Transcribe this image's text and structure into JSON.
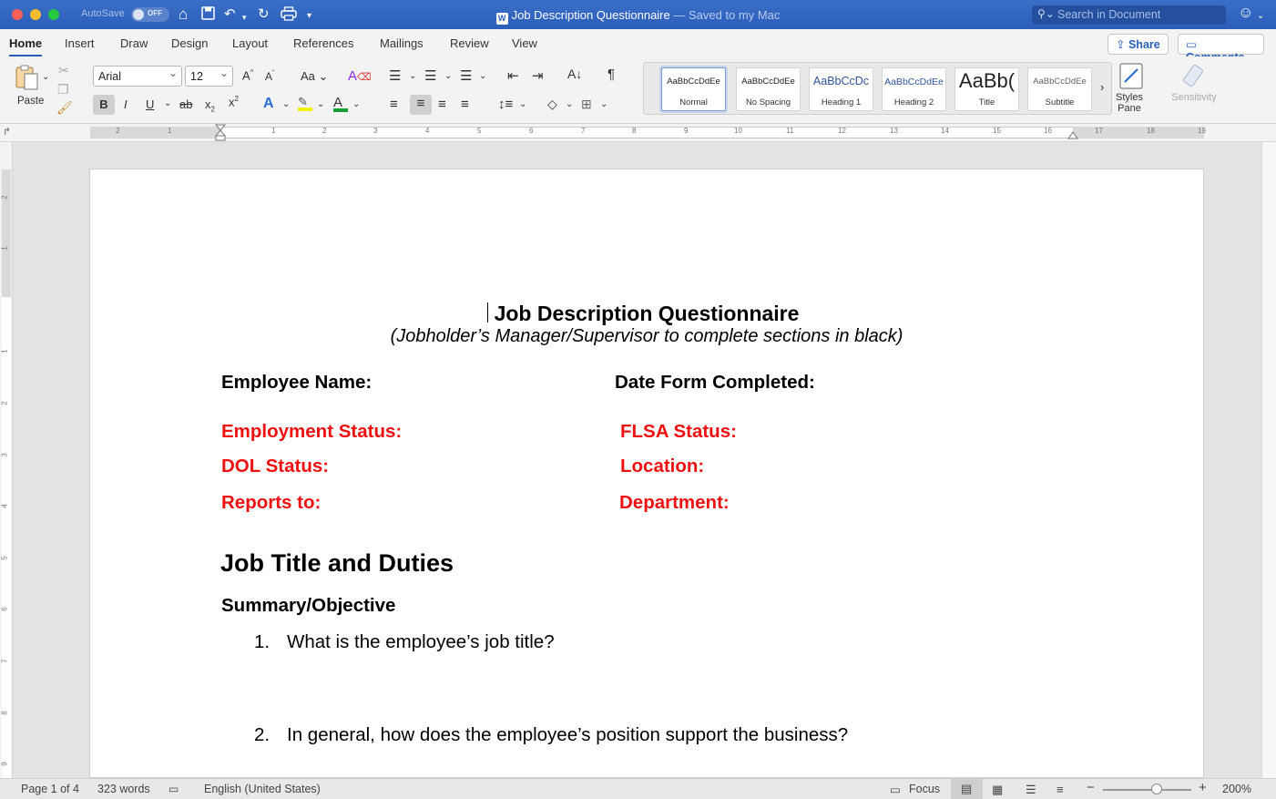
{
  "titlebar": {
    "autosave_label": "AutoSave",
    "autosave_state": "OFF",
    "doc_title": "Job Description Questionnaire",
    "doc_saved": " — Saved to my Mac",
    "search_placeholder": "Search in Document"
  },
  "ribbon_tabs": [
    "Home",
    "Insert",
    "Draw",
    "Design",
    "Layout",
    "References",
    "Mailings",
    "Review",
    "View"
  ],
  "share_label": "Share",
  "comments_label": "Comments",
  "ribbon": {
    "paste_label": "Paste",
    "font_name": "Arial",
    "font_size": "12",
    "styles": [
      {
        "preview": "AaBbCcDdEe",
        "name": "Normal"
      },
      {
        "preview": "AaBbCcDdEe",
        "name": "No Spacing"
      },
      {
        "preview": "AaBbCcDc",
        "name": "Heading 1"
      },
      {
        "preview": "AaBbCcDdEe",
        "name": "Heading 2"
      },
      {
        "preview": "AaBb(",
        "name": "Title"
      },
      {
        "preview": "AaBbCcDdEe",
        "name": "Subtitle"
      }
    ],
    "styles_pane_label": "Styles\nPane",
    "sensitivity_label": "Sensitivity"
  },
  "ruler_numbers": [
    "2",
    "1",
    "1",
    "2",
    "3",
    "4",
    "5",
    "6",
    "7",
    "8",
    "9",
    "10",
    "11",
    "12",
    "13",
    "14",
    "15",
    "16",
    "17",
    "18",
    "19"
  ],
  "vruler_numbers": [
    "2",
    "1",
    "1",
    "2",
    "3",
    "4",
    "5",
    "6",
    "7",
    "8",
    "9"
  ],
  "document": {
    "title": "Job Description Questionnaire",
    "subtitle": "(Jobholder’s Manager/Supervisor to complete sections in black)",
    "employee_name": "Employee Name:",
    "date_completed": "Date Form Completed:",
    "employment_status": "Employment Status:",
    "flsa_status": "FLSA Status:",
    "dol_status": "DOL Status:",
    "location": "Location:",
    "reports_to": "Reports to:",
    "department": "Department:",
    "section_heading": "Job Title and Duties",
    "subsection_heading": "Summary/Objective",
    "questions": [
      {
        "num": "1.",
        "text": "What is the employee’s job title?"
      },
      {
        "num": "2.",
        "text": "In general, how does the employee’s position support the business?"
      }
    ]
  },
  "statusbar": {
    "page": "Page 1 of 4",
    "words": "323 words",
    "language": "English (United States)",
    "focus": "Focus",
    "zoom": "200%"
  },
  "colors": {
    "titlebar": "#2b5eb9",
    "accent": "#2b5eb9",
    "red_text": "#ee1111"
  }
}
